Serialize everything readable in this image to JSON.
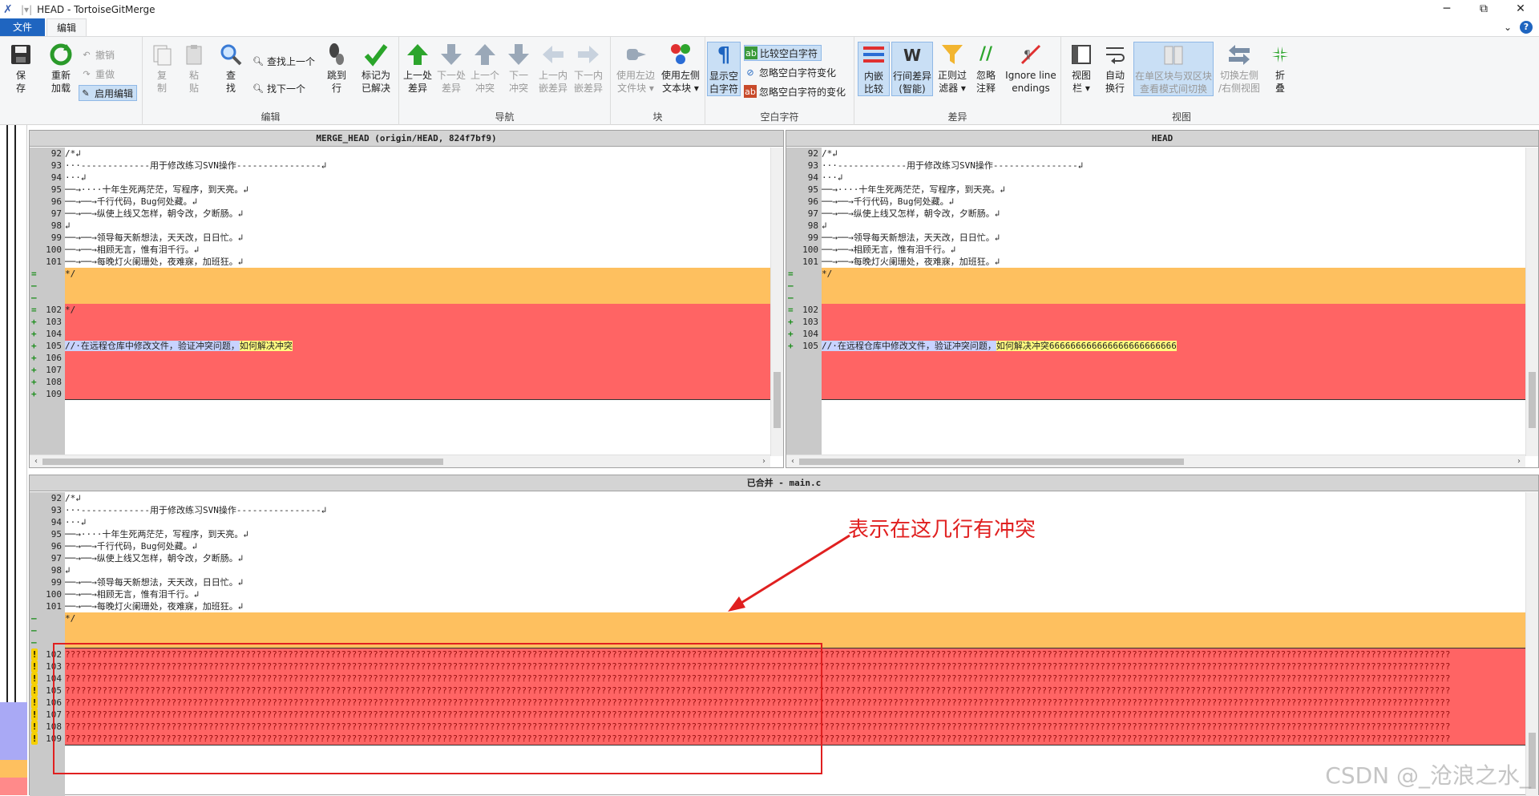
{
  "window": {
    "title": "HEAD - TortoiseGitMerge",
    "minimize": "─",
    "maximize": "⧉",
    "close": "✕"
  },
  "menu": {
    "file": "文件",
    "edit": "编辑",
    "collapse": "⌄",
    "help": "?"
  },
  "ribbon": {
    "groups": {
      "edit": "编辑",
      "nav": "导航",
      "block": "块",
      "ws": "空白字符",
      "diff": "差异",
      "view": "视图"
    },
    "save": "保\n存",
    "reload": "重新\n加载",
    "undo": "撤销",
    "redo": "重做",
    "enable_edit": "启用编辑",
    "copy": "复\n制",
    "paste": "粘\n贴",
    "find": "查\n找",
    "find_prev": "查找上一个",
    "find_next": "找下一个",
    "goto": "跳到\n行",
    "mark_resolved": "标记为\n已解决",
    "prev_diff": "上一处\n差异",
    "next_diff": "下一处\n差异",
    "prev_conflict": "上一个\n冲突",
    "next_conflict": "下一\n冲突",
    "prev_inline": "上一内\n嵌差异",
    "next_inline": "下一内\n嵌差异",
    "use_left_file": "使用左边\n文件块 ▾",
    "use_left_text": "使用左侧\n文本块 ▾",
    "show_ws": "显示空\n白字符",
    "compare_ws": "比较空白字符",
    "ignore_ws_change": "忽略空白字符变化",
    "ignore_ws_all": "忽略空白字符的变化",
    "inline_diff": "内嵌\n比较",
    "line_diff": "行间差异\n(智能)",
    "regex_filter": "正则过\n滤器 ▾",
    "ignore_comments": "忽略\n注释",
    "ignore_line_endings": "Ignore line\nendings",
    "view_bar": "视图\n栏 ▾",
    "auto_wrap": "自动\n换行",
    "switch_mode": "在单区块与双区块\n查看模式间切换",
    "switch_lr": "切换左侧\n/右侧视图",
    "fold": "折\n叠"
  },
  "panes": {
    "left_title": "MERGE_HEAD (origin/HEAD, 824f7bf9)",
    "right_title": "HEAD",
    "bottom_title": "已合并 - main.c"
  },
  "lines": {
    "l92": "/*↲",
    "l93": "···-------------用于修改练习SVN操作----------------↲",
    "l94": "···↲",
    "l95": "──→····十年生死两茫茫，写程序，到天亮。↲",
    "l96": "──→──→千行代码，Bug何处藏。↲",
    "l97": "──→──→纵使上线又怎样，朝令改，夕断肠。↲",
    "l98": "↲",
    "l99": "──→──→领导每天新想法，天天改，日日忙。↲",
    "l100": "──→──→相顾无言，惟有泪千行。↲",
    "l101": "──→──→每晚灯火阑珊处，夜难寐，加班狂。↲",
    "end": "*/",
    "l105_left": "//·在远程仓库中修改文件，验证冲突问题，",
    "l105_left_hl": "如何解决冲突",
    "l105_right_hl": "如何解决冲突666666666666666666666666",
    "conflict_q": "?????????????????????????????????????????????????????????????????????????????????????????????????????????????????????????????????????????????????????????????????????????????????????????????????????????????????????????????????????????????????????????????????????"
  },
  "annotation": "表示在这几行有冲突",
  "watermark": "CSDN @_沧浪之水_",
  "colors": {
    "added": "#ff6464",
    "changed": "#fec05f",
    "inline_hl": "#fffb80",
    "accent": "#1f65c0"
  }
}
